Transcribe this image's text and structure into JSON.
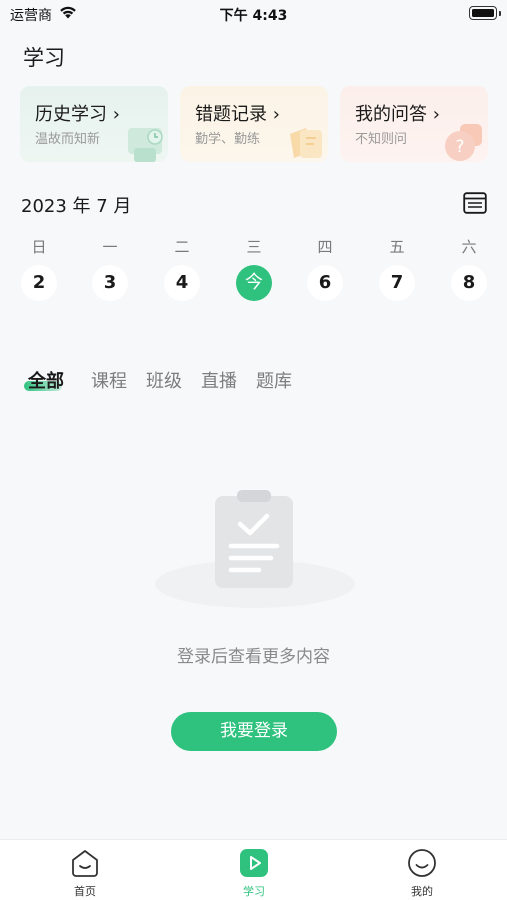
{
  "status_bar": {
    "carrier": "运营商",
    "time": "下午 4:43"
  },
  "page_title": "学习",
  "cards": [
    {
      "title": "历史学习 ›",
      "subtitle": "温故而知新"
    },
    {
      "title": "错题记录 ›",
      "subtitle": "勤学、勤练"
    },
    {
      "title": "我的问答 ›",
      "subtitle": "不知则问"
    }
  ],
  "calendar": {
    "month_label": "2023 年 7 月",
    "weekdays": [
      "日",
      "一",
      "二",
      "三",
      "四",
      "五",
      "六"
    ],
    "days": [
      "2",
      "3",
      "4",
      "今",
      "6",
      "7",
      "8"
    ],
    "today_index": 3
  },
  "tabs": [
    "全部",
    "课程",
    "班级",
    "直播",
    "题库"
  ],
  "empty_state": {
    "message": "登录后查看更多内容",
    "button_label": "我要登录"
  },
  "bottom_nav": [
    {
      "label": "首页",
      "icon": "home-icon"
    },
    {
      "label": "学习",
      "icon": "play-icon"
    },
    {
      "label": "我的",
      "icon": "smiley-icon"
    }
  ],
  "colors": {
    "accent": "#2ec27e",
    "background": "#f7f8fa"
  }
}
